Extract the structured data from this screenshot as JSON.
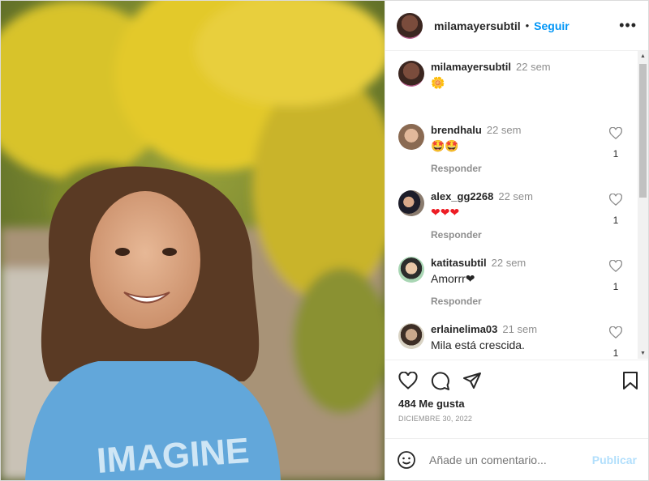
{
  "post": {
    "author": "milamayersubtil",
    "follow_label": "Seguir",
    "separator": "•",
    "more_label": "•••",
    "caption": {
      "username": "milamayersubtil",
      "time": "22 sem",
      "text": "🌼"
    },
    "comments": [
      {
        "username": "brendhalu",
        "time": "22 sem",
        "text": "🤩🤩",
        "reply": "Responder",
        "likes": "1"
      },
      {
        "username": "alex_gg2268",
        "time": "22 sem",
        "text": "❤❤❤",
        "reply": "Responder",
        "likes": "1"
      },
      {
        "username": "katitasubtil",
        "time": "22 sem",
        "text": "Amorrr❤",
        "reply": "Responder",
        "likes": "1"
      },
      {
        "username": "erlainelima03",
        "time": "21 sem",
        "text": "Mila está crescida.",
        "likes": "1"
      }
    ],
    "likes_text": "484 Me gusta",
    "date_text": "DICIEMBRE 30, 2022",
    "add_comment_placeholder": "Añade un comentario...",
    "publish_label": "Publicar",
    "photo_shirt_text": "IMAGINE"
  },
  "colors": {
    "link": "#0095f6",
    "heart": "#ed1c24",
    "publish_disabled": "#b2dffc"
  }
}
